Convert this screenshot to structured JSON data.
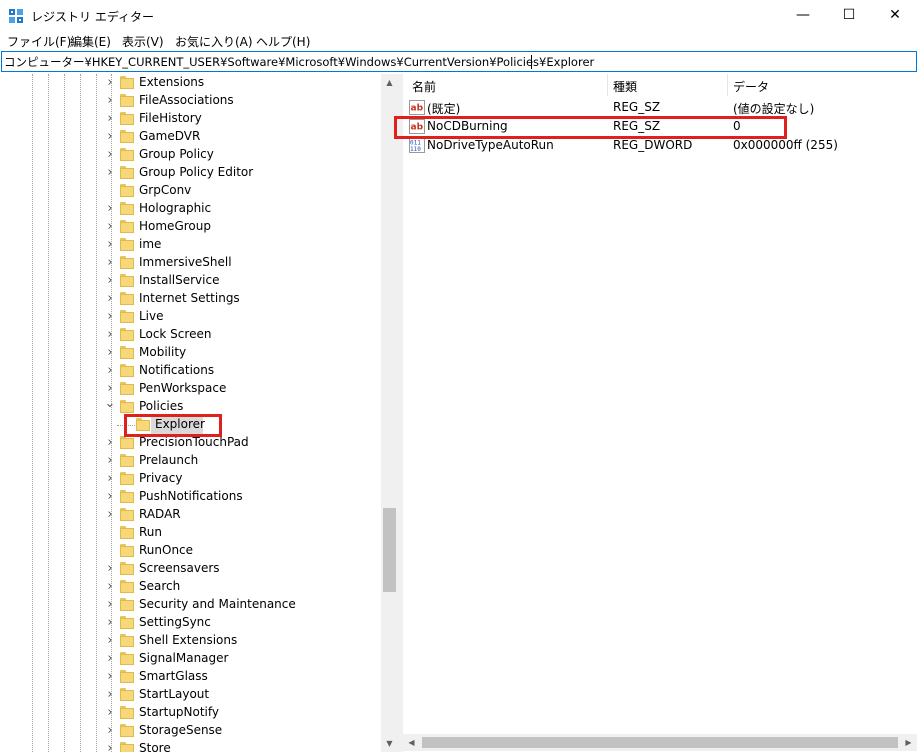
{
  "window": {
    "title": "レジストリ エディター",
    "minimize_glyph": "—",
    "maximize_glyph": "☐",
    "close_glyph": "✕"
  },
  "menu": {
    "items": [
      "ファイル(F)",
      "編集(E)",
      "表示(V)",
      "お気に入り(A)",
      "ヘルプ(H)"
    ]
  },
  "address": {
    "path": "コンピューター¥HKEY_CURRENT_USER¥Software¥Microsoft¥Windows¥CurrentVersion¥Policies¥Explorer"
  },
  "tree": {
    "items": [
      {
        "label": "Extensions",
        "expandable": true
      },
      {
        "label": "FileAssociations",
        "expandable": true
      },
      {
        "label": "FileHistory",
        "expandable": true
      },
      {
        "label": "GameDVR",
        "expandable": true
      },
      {
        "label": "Group Policy",
        "expandable": true
      },
      {
        "label": "Group Policy Editor",
        "expandable": true
      },
      {
        "label": "GrpConv",
        "expandable": false
      },
      {
        "label": "Holographic",
        "expandable": true
      },
      {
        "label": "HomeGroup",
        "expandable": true
      },
      {
        "label": "ime",
        "expandable": true
      },
      {
        "label": "ImmersiveShell",
        "expandable": true
      },
      {
        "label": "InstallService",
        "expandable": true
      },
      {
        "label": "Internet Settings",
        "expandable": true
      },
      {
        "label": "Live",
        "expandable": true
      },
      {
        "label": "Lock Screen",
        "expandable": true
      },
      {
        "label": "Mobility",
        "expandable": true
      },
      {
        "label": "Notifications",
        "expandable": true
      },
      {
        "label": "PenWorkspace",
        "expandable": true
      },
      {
        "label": "Policies",
        "expandable": true,
        "expanded": true
      },
      {
        "label": "Explorer",
        "child": true,
        "selected": true
      },
      {
        "label": "PrecisionTouchPad",
        "expandable": true
      },
      {
        "label": "Prelaunch",
        "expandable": true
      },
      {
        "label": "Privacy",
        "expandable": true
      },
      {
        "label": "PushNotifications",
        "expandable": true
      },
      {
        "label": "RADAR",
        "expandable": true
      },
      {
        "label": "Run",
        "expandable": false
      },
      {
        "label": "RunOnce",
        "expandable": false
      },
      {
        "label": "Screensavers",
        "expandable": true
      },
      {
        "label": "Search",
        "expandable": true
      },
      {
        "label": "Security and Maintenance",
        "expandable": true
      },
      {
        "label": "SettingSync",
        "expandable": true
      },
      {
        "label": "Shell Extensions",
        "expandable": true
      },
      {
        "label": "SignalManager",
        "expandable": true
      },
      {
        "label": "SmartGlass",
        "expandable": true
      },
      {
        "label": "StartLayout",
        "expandable": true
      },
      {
        "label": "StartupNotify",
        "expandable": true
      },
      {
        "label": "StorageSense",
        "expandable": true
      },
      {
        "label": "Store",
        "expandable": true
      }
    ],
    "scroll_arrow_up": "▲",
    "scroll_arrow_down": "▼"
  },
  "values": {
    "columns": [
      "名前",
      "種類",
      "データ"
    ],
    "rows": [
      {
        "name": "(既定)",
        "type": "REG_SZ",
        "data": "(値の設定なし)",
        "icon": "string-value-icon"
      },
      {
        "name": "NoCDBurning",
        "type": "REG_SZ",
        "data": "0",
        "icon": "string-value-icon"
      },
      {
        "name": "NoDriveTypeAutoRun",
        "type": "REG_DWORD",
        "data": "0x000000ff (255)",
        "icon": "binary-value-icon"
      }
    ],
    "scroll_arrow_left": "◀",
    "scroll_arrow_right": "▶"
  },
  "colors": {
    "highlight": "#e0201c",
    "address_border": "#0078d7",
    "folder": "#f6d77a"
  }
}
